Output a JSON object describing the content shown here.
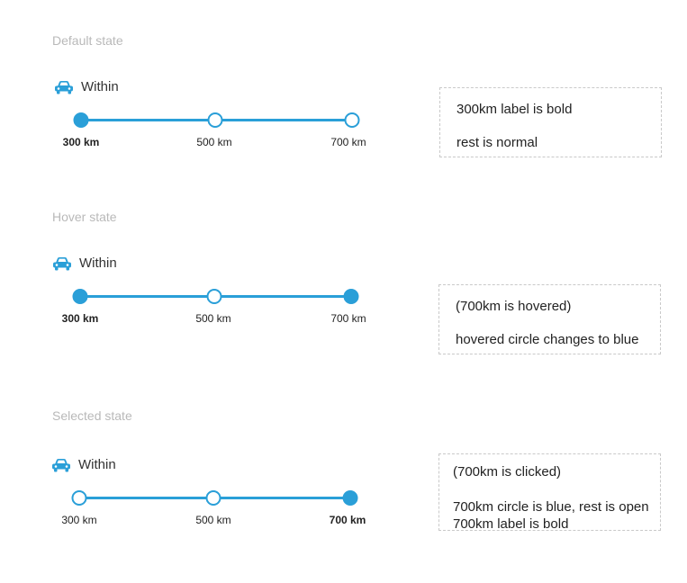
{
  "icon": "car-icon",
  "accent_color": "#2a9fd8",
  "title_color": "#b9b9b9",
  "states": [
    {
      "title": "Default state",
      "within_label": "Within",
      "ticks": [
        {
          "label": "300 km",
          "filled": true,
          "bold": true
        },
        {
          "label": "500 km",
          "filled": false,
          "bold": false
        },
        {
          "label": "700 km",
          "filled": false,
          "bold": false
        }
      ],
      "note_lines": [
        "300km label is bold",
        "rest is normal"
      ]
    },
    {
      "title": "Hover state",
      "within_label": "Within",
      "ticks": [
        {
          "label": "300 km",
          "filled": true,
          "bold": true
        },
        {
          "label": "500 km",
          "filled": false,
          "bold": false
        },
        {
          "label": "700 km",
          "filled": true,
          "bold": false
        }
      ],
      "note_lines": [
        "(700km is hovered)",
        "hovered circle changes to blue"
      ]
    },
    {
      "title": "Selected state",
      "within_label": "Within",
      "ticks": [
        {
          "label": "300 km",
          "filled": false,
          "bold": false
        },
        {
          "label": "500 km",
          "filled": false,
          "bold": false
        },
        {
          "label": "700 km",
          "filled": true,
          "bold": true
        }
      ],
      "note_lines": [
        "(700km is clicked)",
        "700km circle is blue, rest is open",
        "700km label is bold"
      ]
    }
  ]
}
